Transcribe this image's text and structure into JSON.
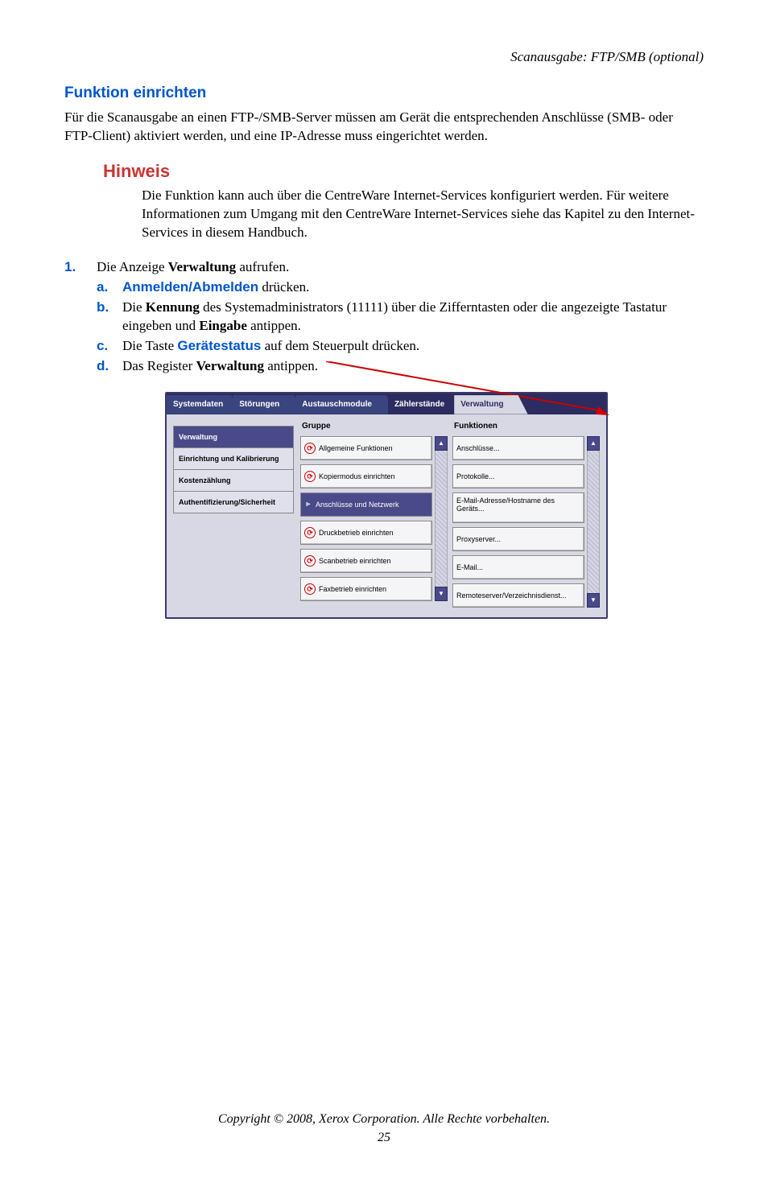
{
  "running_head": "Scanausgabe: FTP/SMB (optional)",
  "h_section": "Funktion einrichten",
  "intro": "Für die Scanausgabe an einen FTP-/SMB-Server müssen am Gerät die entsprechenden Anschlüsse (SMB- oder FTP-Client) aktiviert werden, und eine IP-Adresse muss eingerichtet werden.",
  "note": {
    "title": "Hinweis",
    "body": "Die Funktion kann auch über die CentreWare Internet-Services konfiguriert werden. Für weitere Informationen zum Umgang mit den CentreWare Internet-Services siehe das Kapitel zu den Internet-Services in diesem Handbuch."
  },
  "step1": {
    "num": "1.",
    "intro_pre": "Die Anzeige ",
    "intro_bold": "Verwaltung",
    "intro_post": " aufrufen.",
    "a": {
      "letter": "a.",
      "kw": "Anmelden/Abmelden",
      "rest": " drücken."
    },
    "b": {
      "letter": "b.",
      "pre": "Die ",
      "b1": "Kennung",
      "mid": " des Systemadministrators (11111) über die Zifferntasten oder die angezeigte Tastatur eingeben und ",
      "b2": "Eingabe",
      "post": " antippen."
    },
    "c": {
      "letter": "c.",
      "pre": "Die Taste ",
      "kw": "Gerätestatus",
      "post": " auf dem Steuerpult drücken."
    },
    "d": {
      "letter": "d.",
      "pre": "Das Register ",
      "b1": "Verwaltung",
      "post": " antippen."
    }
  },
  "ui": {
    "tabs": {
      "t1": "Systemdaten",
      "t2": "Störungen",
      "t3": "Austauschmodule",
      "t4": "Zählerstände",
      "t5": "Verwaltung"
    },
    "side": {
      "s1": "Verwaltung",
      "s2": "Einrichtung und Kalibrierung",
      "s3": "Kostenzählung",
      "s4": "Authentifizierung/Sicherheit"
    },
    "colA": {
      "head": "Gruppe",
      "i1": "Allgemeine Funktionen",
      "i2": "Kopiermodus einrichten",
      "i3": "Anschlüsse und Netzwerk",
      "i4": "Druckbetrieb einrichten",
      "i5": "Scanbetrieb einrichten",
      "i6": "Faxbetrieb einrichten"
    },
    "colB": {
      "head": "Funktionen",
      "i1": "Anschlüsse...",
      "i2": "Protokolle...",
      "i3": "E-Mail-Adresse/Hostname des Geräts...",
      "i4": "Proxyserver...",
      "i5": "E-Mail...",
      "i6": "Remoteserver/Verzeichnisdienst..."
    }
  },
  "footer": {
    "copyright": "Copyright © 2008, Xerox Corporation. Alle Rechte vorbehalten.",
    "page": "25"
  }
}
